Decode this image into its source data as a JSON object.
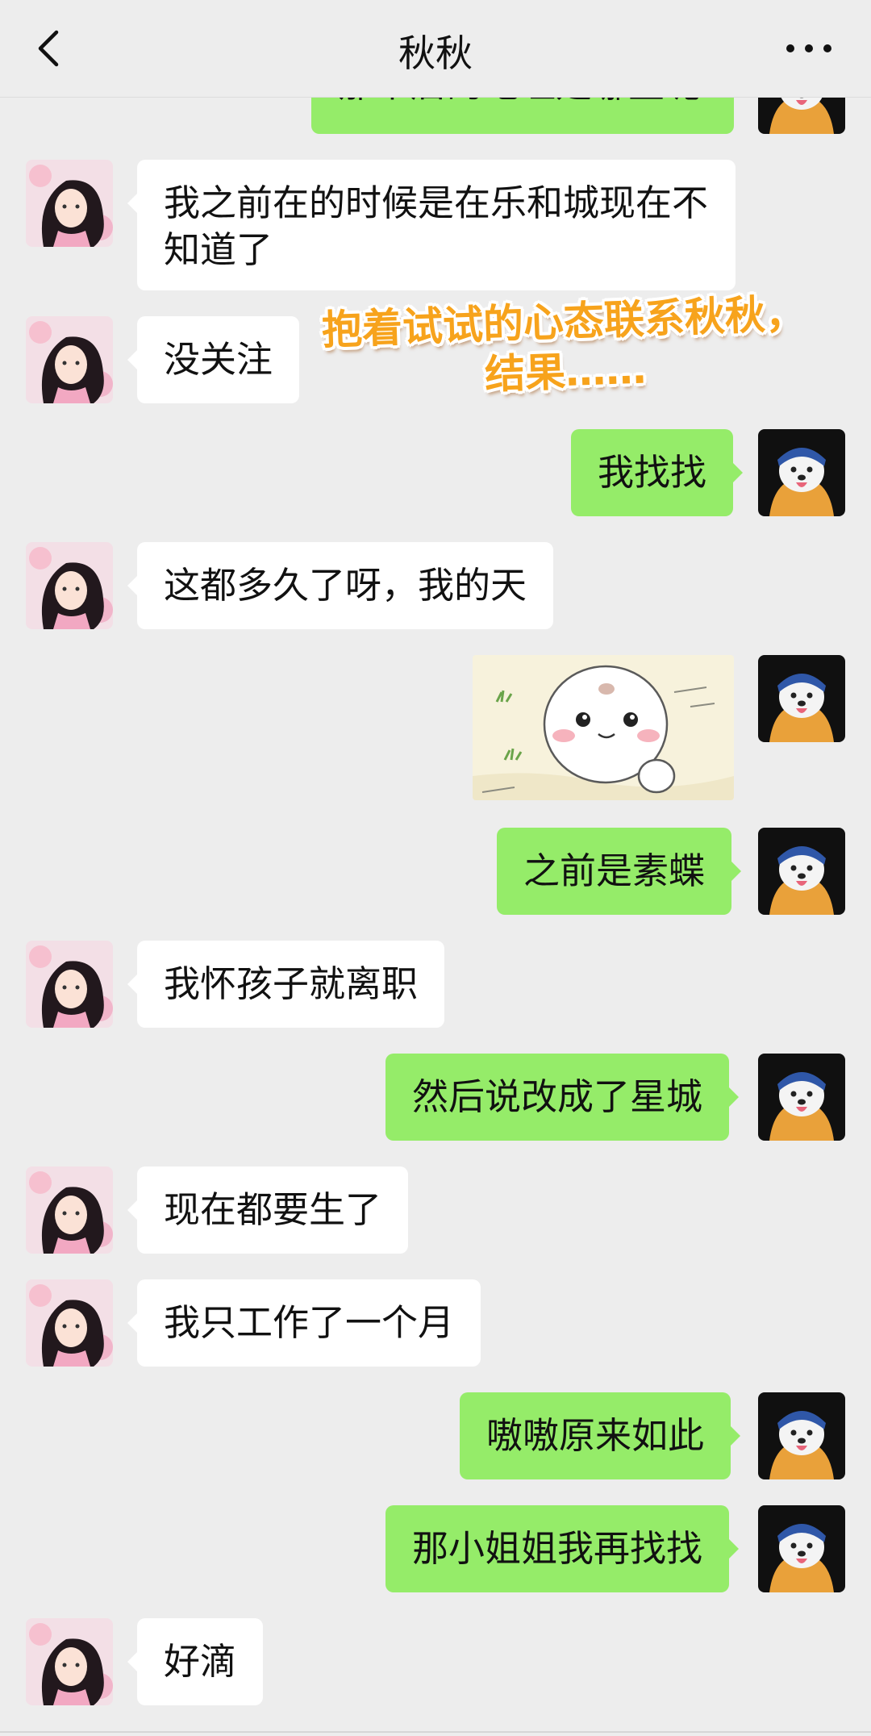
{
  "header": {
    "title": "秋秋"
  },
  "caption": {
    "line1": "抱着试试的心态联系秋秋，",
    "line2": "结果……"
  },
  "messages": {
    "m0": "那个店的地址是哪里呢",
    "m1": "我之前在的时候是在乐和城现在不知道了",
    "m2": "没关注",
    "m3": "我找找",
    "m4": "这都多久了呀，我的天",
    "m6": "之前是素蝶",
    "m7": "我怀孩子就离职",
    "m8": "然后说改成了星城",
    "m9": "现在都要生了",
    "m10": "我只工作了一个月",
    "m11": "嗷嗷原来如此",
    "m12": "那小姐姐我再找找",
    "m13": "好滴"
  },
  "colors": {
    "background": "#ededed",
    "incoming": "#ffffff",
    "outgoing": "#95ec69",
    "caption": "#f7a31c"
  },
  "icons": [
    "back-arrow-icon",
    "more-dots-icon"
  ]
}
